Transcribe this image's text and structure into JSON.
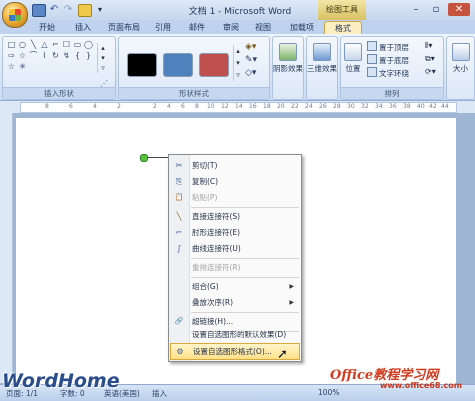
{
  "title_bar": {
    "window_title": "文档 1 - Microsoft Word",
    "context_tab_group": "绘图工具",
    "buttons": {
      "minimize": "–",
      "restore": "▫",
      "close": "✕"
    }
  },
  "tabs": [
    {
      "label": "开始"
    },
    {
      "label": "插入"
    },
    {
      "label": "页面布局"
    },
    {
      "label": "引用"
    },
    {
      "label": "邮件"
    },
    {
      "label": "审阅"
    },
    {
      "label": "视图"
    },
    {
      "label": "加载项"
    },
    {
      "label": "格式",
      "active": true
    }
  ],
  "ribbon": {
    "insert_shapes": {
      "label": "插入形状",
      "shape_icons": [
        "□",
        "○",
        "╲",
        "△",
        "⌐",
        "☐",
        "▭",
        "◯",
        "⇨",
        "☆",
        "⌒",
        "⌇",
        "↻",
        "↯",
        "{",
        "}",
        "☆",
        "✳"
      ]
    },
    "shape_styles": {
      "label": "形状样式",
      "swatches": [
        "#000000",
        "#4f81bd",
        "#c0504d"
      ]
    },
    "shadow_effects": {
      "label": "阴影效果"
    },
    "three_d_effects": {
      "label": "三维效果"
    },
    "arrange": {
      "label": "排列",
      "position": "位置",
      "bring_to_front": "置于顶层",
      "send_to_back": "置于底层",
      "text_wrapping": "文字环绕"
    },
    "size": {
      "label": "大小"
    }
  },
  "ruler_ticks": [
    "8",
    "6",
    "4",
    "2",
    "2",
    "4",
    "6",
    "8",
    "10",
    "12",
    "14",
    "16",
    "18",
    "20",
    "22",
    "24",
    "26",
    "28",
    "30",
    "32",
    "34",
    "36",
    "38",
    "40",
    "42",
    "44",
    "46",
    "48"
  ],
  "context_menu": [
    {
      "icon": "✂",
      "label": "剪切(T)",
      "name": "cut"
    },
    {
      "icon": "⎘",
      "label": "复制(C)",
      "name": "copy"
    },
    {
      "icon": "📋",
      "label": "粘贴(P)",
      "name": "paste",
      "disabled": true
    },
    {
      "sep": true
    },
    {
      "icon": "╲",
      "label": "直接连接符(S)",
      "name": "straight-connector"
    },
    {
      "icon": "⌐",
      "label": "肘形连接符(E)",
      "name": "elbow-connector"
    },
    {
      "icon": "∫",
      "label": "曲线连接符(U)",
      "name": "curved-connector"
    },
    {
      "sep": true
    },
    {
      "icon": "",
      "label": "重排连接符(R)",
      "name": "reroute-connectors",
      "disabled": true
    },
    {
      "sep": true
    },
    {
      "icon": "",
      "label": "组合(G)",
      "name": "group",
      "submenu": true
    },
    {
      "icon": "",
      "label": "叠放次序(R)",
      "name": "order",
      "submenu": true
    },
    {
      "sep": true
    },
    {
      "icon": "🔗",
      "label": "超链接(H)...",
      "name": "hyperlink"
    },
    {
      "sep": true
    },
    {
      "icon": "",
      "label": "设置自选图形的默认效果(D)",
      "name": "set-default"
    },
    {
      "icon": "⚙",
      "label": "设置自选图形格式(O)...",
      "name": "format-autoshape",
      "highlighted": true
    }
  ],
  "status_bar": {
    "page": "页面: 1/1",
    "words": "字数: 0",
    "language": "英语(美国)",
    "mode": "插入",
    "zoom": "100%"
  },
  "watermarks": {
    "left": "WordHome",
    "right": "Office教程学习网",
    "right_url": "www.office68.com"
  }
}
